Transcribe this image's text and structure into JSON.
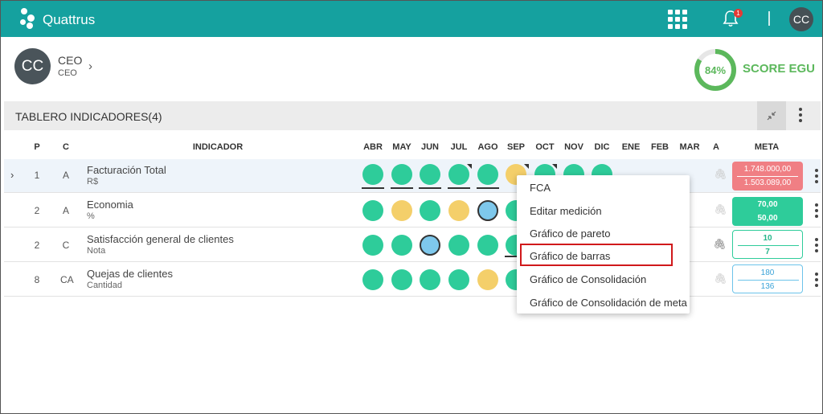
{
  "topbar": {
    "brand": "Quattrus",
    "notification_count": "1",
    "avatar_initials": "CC",
    "color": "#15a19f"
  },
  "user": {
    "initials": "CC",
    "name": "CEO",
    "role": "CEO"
  },
  "score": {
    "percent_label": "84%",
    "value": 84,
    "label": "SCORE EGU",
    "color": "#5cb85c"
  },
  "board": {
    "title": "TABLERO INDICADORES(4)"
  },
  "columns": {
    "p": "P",
    "c": "C",
    "indicator": "INDICADOR",
    "months": [
      "ABR",
      "MAY",
      "JUN",
      "JUL",
      "AGO",
      "SEP",
      "OCT",
      "NOV",
      "DIC",
      "ENE",
      "FEB",
      "MAR"
    ],
    "a": "A",
    "meta": "META"
  },
  "rows": [
    {
      "p": "1",
      "c": "A",
      "name": "Facturación Total",
      "unit": "R$",
      "statuses": [
        "green",
        "green",
        "green",
        "green",
        "green",
        "yellow",
        "green",
        "green",
        "green"
      ],
      "meta_top": "1.748.000,00",
      "meta_bottom": "1.503.089,00",
      "meta_color": "red"
    },
    {
      "p": "2",
      "c": "A",
      "name": "Economia",
      "unit": "%",
      "statuses": [
        "green",
        "yellow",
        "green",
        "yellow",
        "blue",
        "green"
      ],
      "meta_top": "70,00",
      "meta_bottom": "50,00",
      "meta_color": "green"
    },
    {
      "p": "2",
      "c": "C",
      "name": "Satisfacción general de clientes",
      "unit": "Nota",
      "statuses": [
        "green",
        "green",
        "blue",
        "green",
        "green",
        "green"
      ],
      "meta_top": "10",
      "meta_bottom": "7",
      "meta_color": "teal"
    },
    {
      "p": "8",
      "c": "CA",
      "name": "Quejas de clientes",
      "unit": "Cantidad",
      "statuses": [
        "green",
        "green",
        "green",
        "green",
        "yellow",
        "green"
      ],
      "meta_top": "180",
      "meta_bottom": "136",
      "meta_color": "blue"
    }
  ],
  "context_menu": {
    "items": [
      "FCA",
      "Editar medición",
      "Gráfico de pareto",
      "Gráfico de barras",
      "Gráfico de Consolidación",
      "Gráfico de Consolidación de meta"
    ],
    "highlighted": "Gráfico de barras",
    "highlight_color": "#d0191b"
  },
  "status_colors": {
    "green": "#2ecc9a",
    "yellow": "#f4cf6a",
    "blue": "#7ec8ec"
  }
}
